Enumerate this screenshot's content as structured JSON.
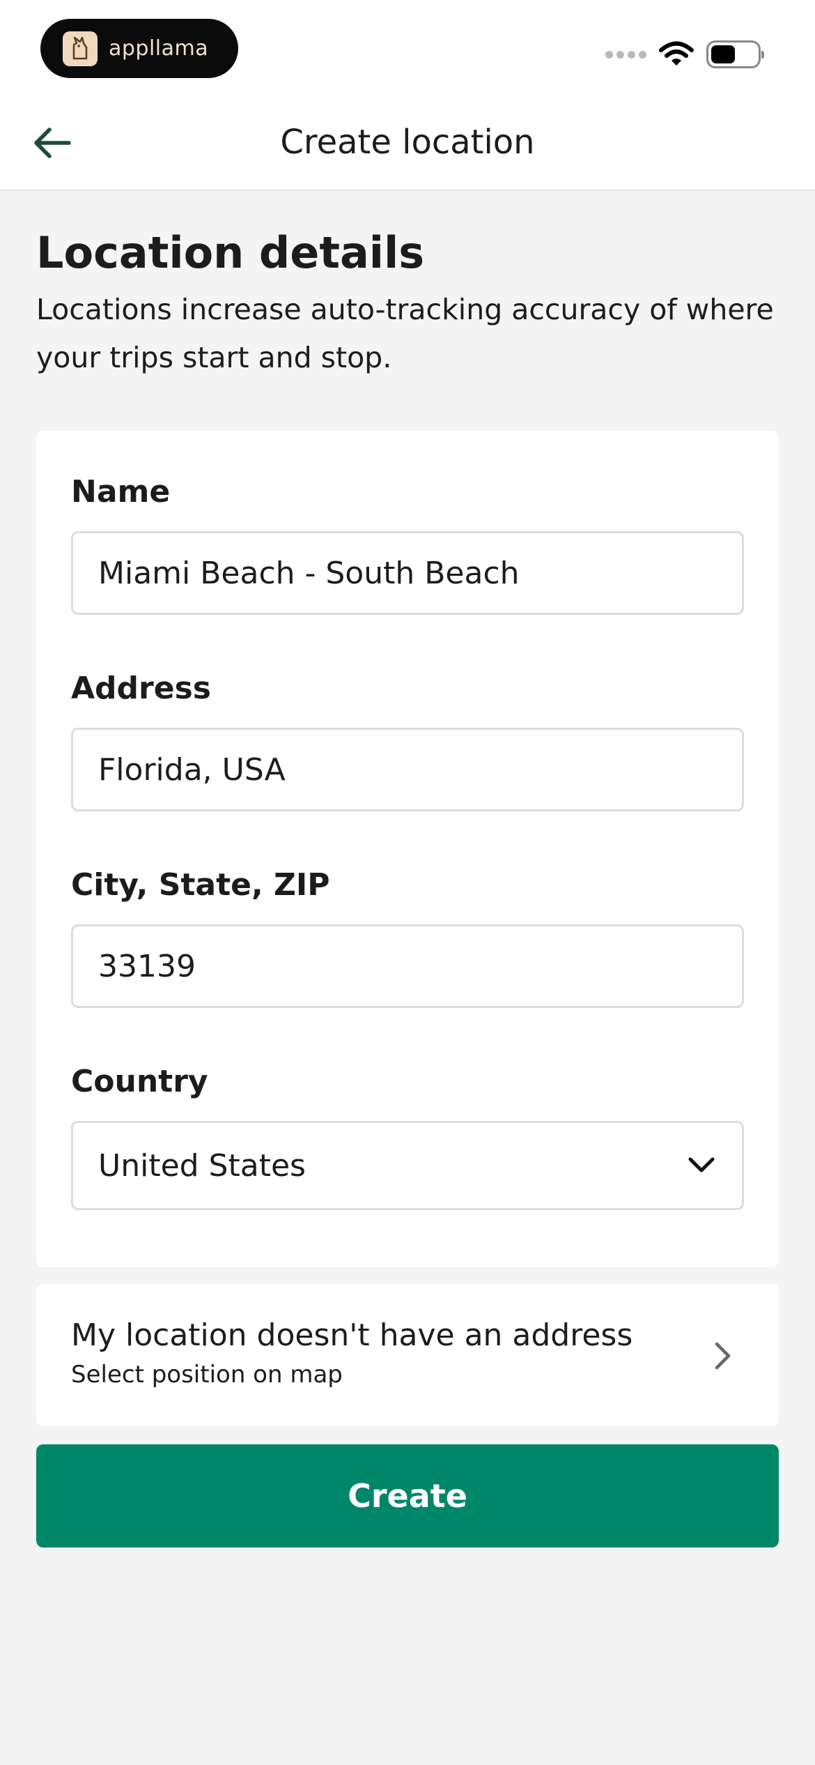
{
  "status_bar": {
    "brand_name": "appllama"
  },
  "header": {
    "title": "Create location"
  },
  "intro": {
    "title": "Location details",
    "description": "Locations increase auto-tracking accuracy of where your trips start and stop."
  },
  "form": {
    "name": {
      "label": "Name",
      "value": "Miami Beach - South Beach"
    },
    "address": {
      "label": "Address",
      "value": "Florida, USA"
    },
    "city_state_zip": {
      "label": "City, State, ZIP",
      "value": "33139"
    },
    "country": {
      "label": "Country",
      "value": "United States"
    }
  },
  "no_address": {
    "title": "My location doesn't have an address",
    "subtitle": "Select position on map"
  },
  "actions": {
    "create_label": "Create"
  },
  "colors": {
    "accent": "#008769",
    "background": "#f4f4f4",
    "card": "#ffffff",
    "text": "#1c1c1c"
  }
}
